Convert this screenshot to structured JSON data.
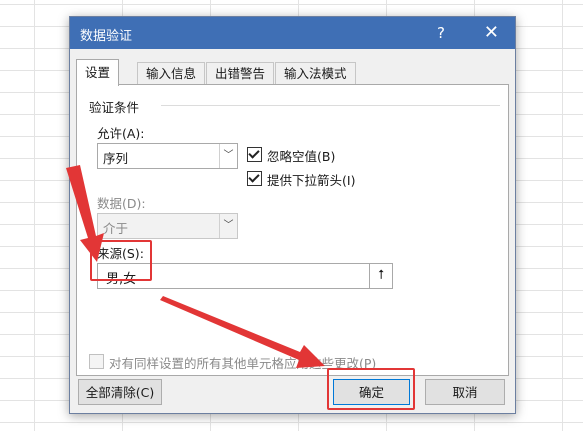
{
  "dialog": {
    "title": "数据验证",
    "help": "?",
    "close": "✕"
  },
  "tabs": [
    {
      "label": "设置",
      "active": true
    },
    {
      "label": "输入信息",
      "active": false
    },
    {
      "label": "出错警告",
      "active": false
    },
    {
      "label": "输入法模式",
      "active": false
    }
  ],
  "settings": {
    "group_label": "验证条件",
    "allow_label": "允许(A):",
    "allow_value": "序列",
    "ignore_blank_label": "忽略空值(B)",
    "ignore_blank_checked": true,
    "dropdown_label": "提供下拉箭头(I)",
    "dropdown_checked": true,
    "data_label": "数据(D):",
    "data_value": "介于",
    "source_label": "来源(S):",
    "source_value": "男,女",
    "collapse_icon": "⭡",
    "apply_all_label": "对有同样设置的所有其他单元格应用这些更改(P)",
    "apply_all_checked": false
  },
  "buttons": {
    "clear_all": "全部清除(C)",
    "ok": "确定",
    "cancel": "取消"
  },
  "colors": {
    "titlebar": "#3f6fb5",
    "annotation_red": "#e23636"
  }
}
